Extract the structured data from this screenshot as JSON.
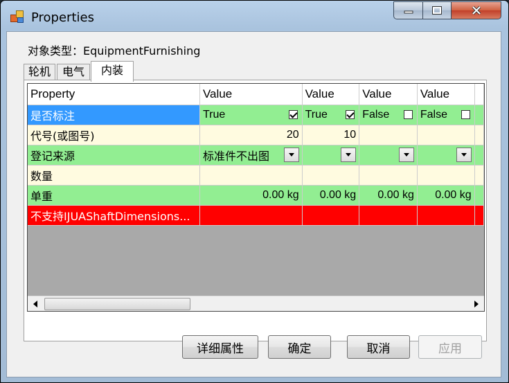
{
  "window": {
    "title": "Properties"
  },
  "object_type": "对象类型：EquipmentFurnishing",
  "tabs": [
    {
      "label": "轮机",
      "active": false
    },
    {
      "label": "电气",
      "active": false
    },
    {
      "label": "内装",
      "active": true
    }
  ],
  "grid": {
    "headers": [
      "Property",
      "Value",
      "Value",
      "Value",
      "Value"
    ],
    "rows": {
      "mark": {
        "name": "是否标注",
        "cells": [
          {
            "text": "True",
            "checked": true
          },
          {
            "text": "True",
            "checked": true
          },
          {
            "text": "False",
            "checked": false
          },
          {
            "text": "False",
            "checked": false
          }
        ]
      },
      "code": {
        "name": "代号(或图号)",
        "cells": [
          "20",
          "10",
          "",
          ""
        ]
      },
      "source": {
        "name": "登记来源",
        "cells": [
          "标准件不出图",
          "",
          "",
          ""
        ]
      },
      "quantity": {
        "name": "数量",
        "cells": [
          "",
          "",
          "",
          ""
        ]
      },
      "unit_weight": {
        "name": "单重",
        "cells": [
          "0.00 kg",
          "0.00 kg",
          "0.00 kg",
          "0.00 kg"
        ]
      },
      "unsupported": {
        "name": "不支持IJUAShaftDimensions..."
      }
    }
  },
  "buttons": {
    "details": "详细属性",
    "ok": "确定",
    "cancel": "取消",
    "apply": "应用"
  },
  "colors": {
    "green_row": "#92ee92",
    "yellow_row": "#fffbe0",
    "error_row": "#ff0000",
    "selection": "#3399ff"
  }
}
